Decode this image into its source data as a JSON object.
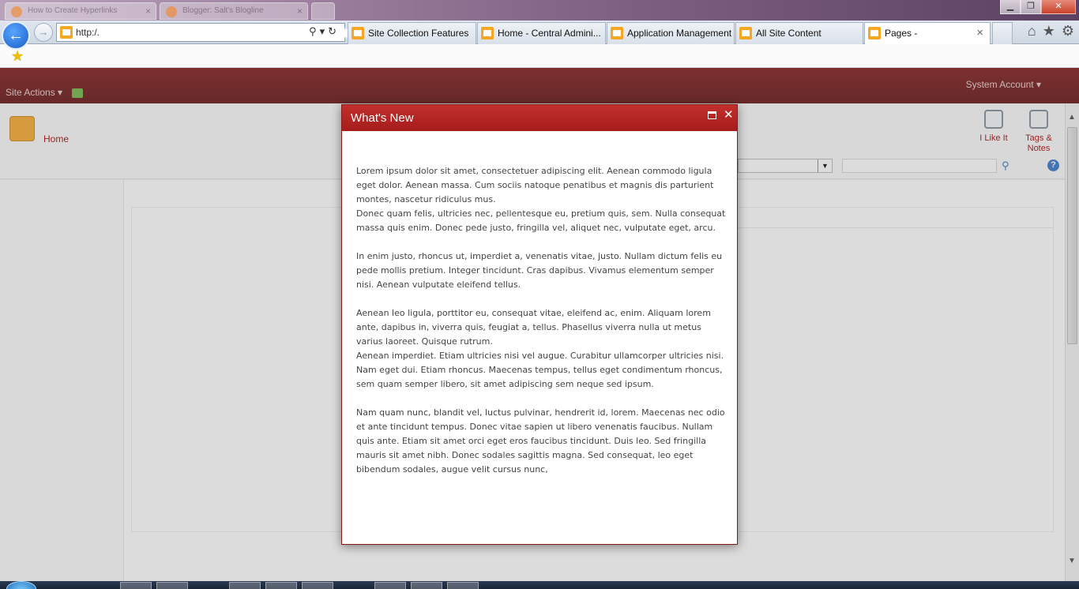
{
  "browser": {
    "background_tabs": [
      "How to Create Hyperlinks",
      "Blogger: Salt's Blogline"
    ],
    "window_controls": {
      "minimize_icon": "minimize-icon",
      "maximize_icon": "maximize-icon",
      "close_icon": "close-icon"
    },
    "address": "http:/.",
    "tabs": [
      {
        "label": "Site Collection Features",
        "active": false
      },
      {
        "label": "Home - Central Admini...",
        "active": false
      },
      {
        "label": "Application Management",
        "active": false
      },
      {
        "label": "All Site Content",
        "active": false
      },
      {
        "label": "Pages -",
        "active": true
      }
    ],
    "tab_close": "×",
    "right_icons": [
      "home-icon",
      "star-icon",
      "gear-icon"
    ]
  },
  "sharepoint": {
    "site_actions": "Site Actions ▾",
    "system_account": "System Account ▾",
    "home_link": "Home",
    "i_like_it": "I Like It",
    "tags_notes": "Tags & Notes",
    "help": "?"
  },
  "dialog": {
    "title": "What's New",
    "paragraphs": [
      {
        "lines": [
          "Lorem ipsum dolor sit amet, consectetuer adipiscing elit. Aenean commodo ligula eget dolor. Aenean massa. Cum sociis natoque penatibus et magnis dis parturient montes, nascetur ridiculus mus.",
          "Donec quam felis, ultricies nec, pellentesque eu, pretium quis, sem. Nulla consequat massa quis enim. Donec pede justo, fringilla vel, aliquet nec, vulputate eget, arcu."
        ]
      },
      {
        "lines": [
          "In enim justo, rhoncus ut, imperdiet a, venenatis vitae, justo. Nullam dictum felis eu pede mollis pretium. Integer tincidunt. Cras dapibus. Vivamus elementum semper nisi. Aenean vulputate eleifend tellus."
        ]
      },
      {
        "lines": [
          "Aenean leo ligula, porttitor eu, consequat vitae, eleifend ac, enim. Aliquam lorem ante, dapibus in, viverra quis, feugiat a, tellus. Phasellus viverra nulla ut metus varius laoreet. Quisque rutrum.",
          "Aenean imperdiet. Etiam ultricies nisi vel augue. Curabitur ullamcorper ultricies nisi. Nam eget dui. Etiam rhoncus. Maecenas tempus, tellus eget condimentum rhoncus, sem quam semper libero, sit amet adipiscing sem neque sed ipsum."
        ]
      },
      {
        "lines": [
          "Nam quam nunc, blandit vel, luctus pulvinar, hendrerit id, lorem. Maecenas nec odio et ante tincidunt tempus. Donec vitae sapien ut libero venenatis faucibus. Nullam quis ante. Etiam sit amet orci eget eros faucibus tincidunt. Duis leo. Sed fringilla mauris sit amet nibh. Donec sodales sagittis magna. Sed consequat, leo eget bibendum sodales, augue velit cursus nunc,"
        ]
      }
    ]
  },
  "colors": {
    "ribbon": "#6b0b0b",
    "dialog_header": "#b52525",
    "link": "#a30000"
  }
}
